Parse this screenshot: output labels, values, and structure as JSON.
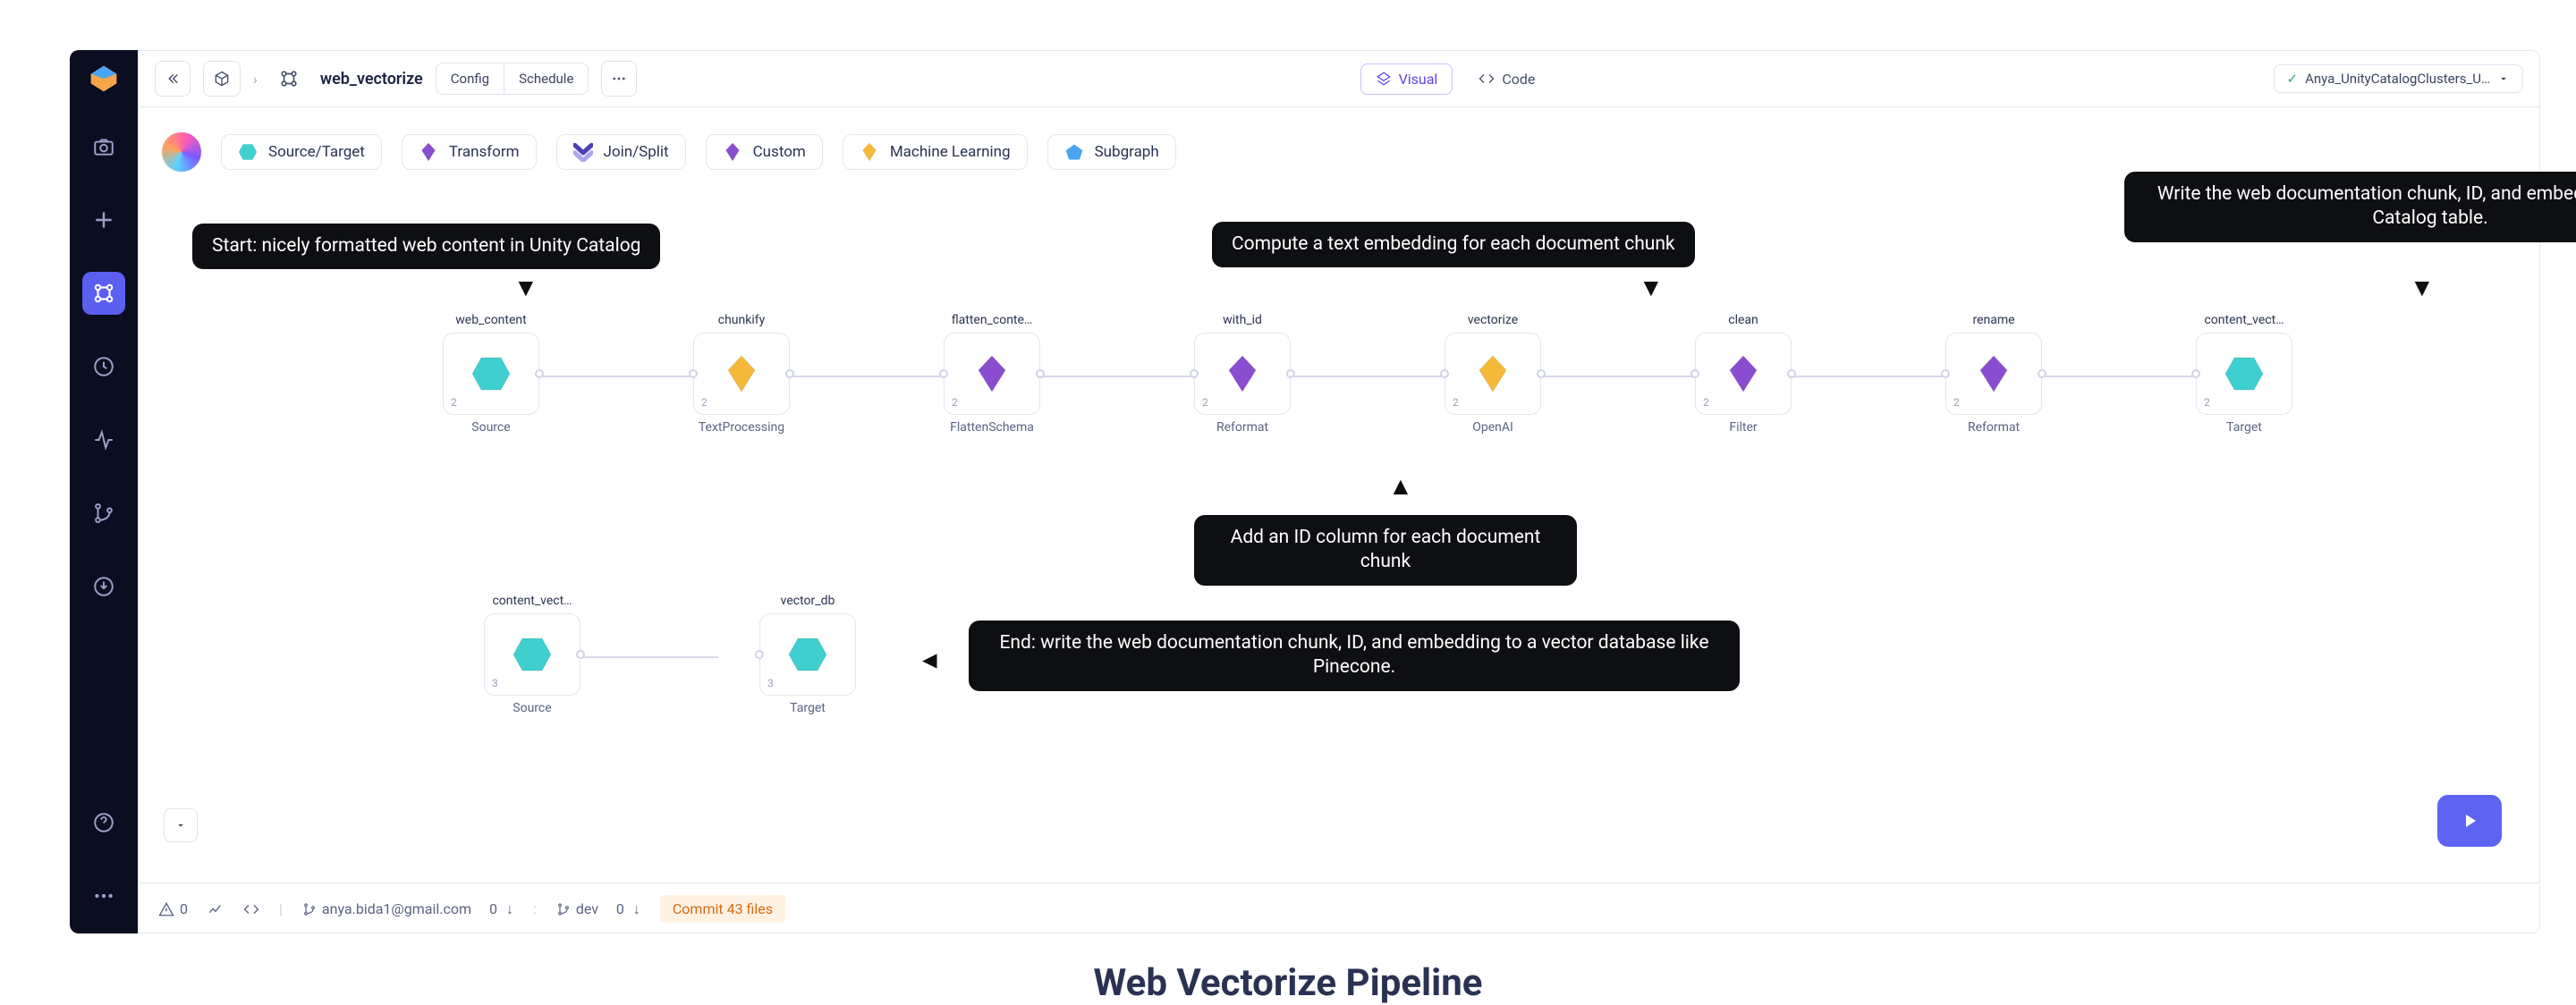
{
  "toolbar": {
    "pipeline_name": "web_vectorize",
    "config_label": "Config",
    "schedule_label": "Schedule",
    "visual_label": "Visual",
    "code_label": "Code",
    "cluster_name": "Anya_UnityCatalogClusters_U…"
  },
  "palette": [
    {
      "label": "Source/Target",
      "color": "#3fcfcf",
      "shape": "hex"
    },
    {
      "label": "Transform",
      "color": "#8a4dd0",
      "shape": "diamond"
    },
    {
      "label": "Join/Split",
      "color": "#4b3fb8",
      "shape": "chev"
    },
    {
      "label": "Custom",
      "color": "#8a4dd0",
      "shape": "diamond"
    },
    {
      "label": "Machine Learning",
      "color": "#f5b93a",
      "shape": "diamond"
    },
    {
      "label": "Subgraph",
      "color": "#4aa6f0",
      "shape": "pent"
    }
  ],
  "nodes_row1": [
    {
      "top": "web_content",
      "type": "Source",
      "shape": "hex",
      "color": "#3fcfcf",
      "n": "2"
    },
    {
      "top": "chunkify",
      "type": "TextProcessing",
      "shape": "diamond",
      "color": "#f5b93a",
      "n": "2"
    },
    {
      "top": "flatten_conte…",
      "type": "FlattenSchema",
      "shape": "diamond",
      "color": "#8a4dd0",
      "n": "2"
    },
    {
      "top": "with_id",
      "type": "Reformat",
      "shape": "diamond",
      "color": "#8a4dd0",
      "n": "2"
    },
    {
      "top": "vectorize",
      "type": "OpenAI",
      "shape": "diamond",
      "color": "#f5b93a",
      "n": "2"
    },
    {
      "top": "clean",
      "type": "Filter",
      "shape": "diamond",
      "color": "#8a4dd0",
      "n": "2"
    },
    {
      "top": "rename",
      "type": "Reformat",
      "shape": "diamond",
      "color": "#8a4dd0",
      "n": "2"
    },
    {
      "top": "content_vect…",
      "type": "Target",
      "shape": "hex",
      "color": "#3fcfcf",
      "n": "2"
    }
  ],
  "nodes_row2": [
    {
      "top": "content_vect…",
      "type": "Source",
      "shape": "hex",
      "color": "#3fcfcf",
      "n": "3"
    },
    {
      "top": "vector_db",
      "type": "Target",
      "shape": "hex",
      "color": "#3fcfcf",
      "n": "3"
    }
  ],
  "callouts": {
    "start": "Start: nicely formatted web content in Unity Catalog",
    "vectorize": "Compute a text embedding for each document chunk",
    "target1": "Write the web documentation chunk, ID, and embedding to a Unity Catalog table.",
    "id": "Add an ID column for each document chunk",
    "end": "End: write the web documentation chunk, ID, and embedding to a vector database like Pinecone."
  },
  "statusbar": {
    "warn_count": "0",
    "user": "anya.bida1@gmail.com",
    "user_changes": "0",
    "branch": "dev",
    "branch_changes": "0",
    "commit_label": "Commit 43 files"
  },
  "caption": "Web Vectorize Pipeline"
}
